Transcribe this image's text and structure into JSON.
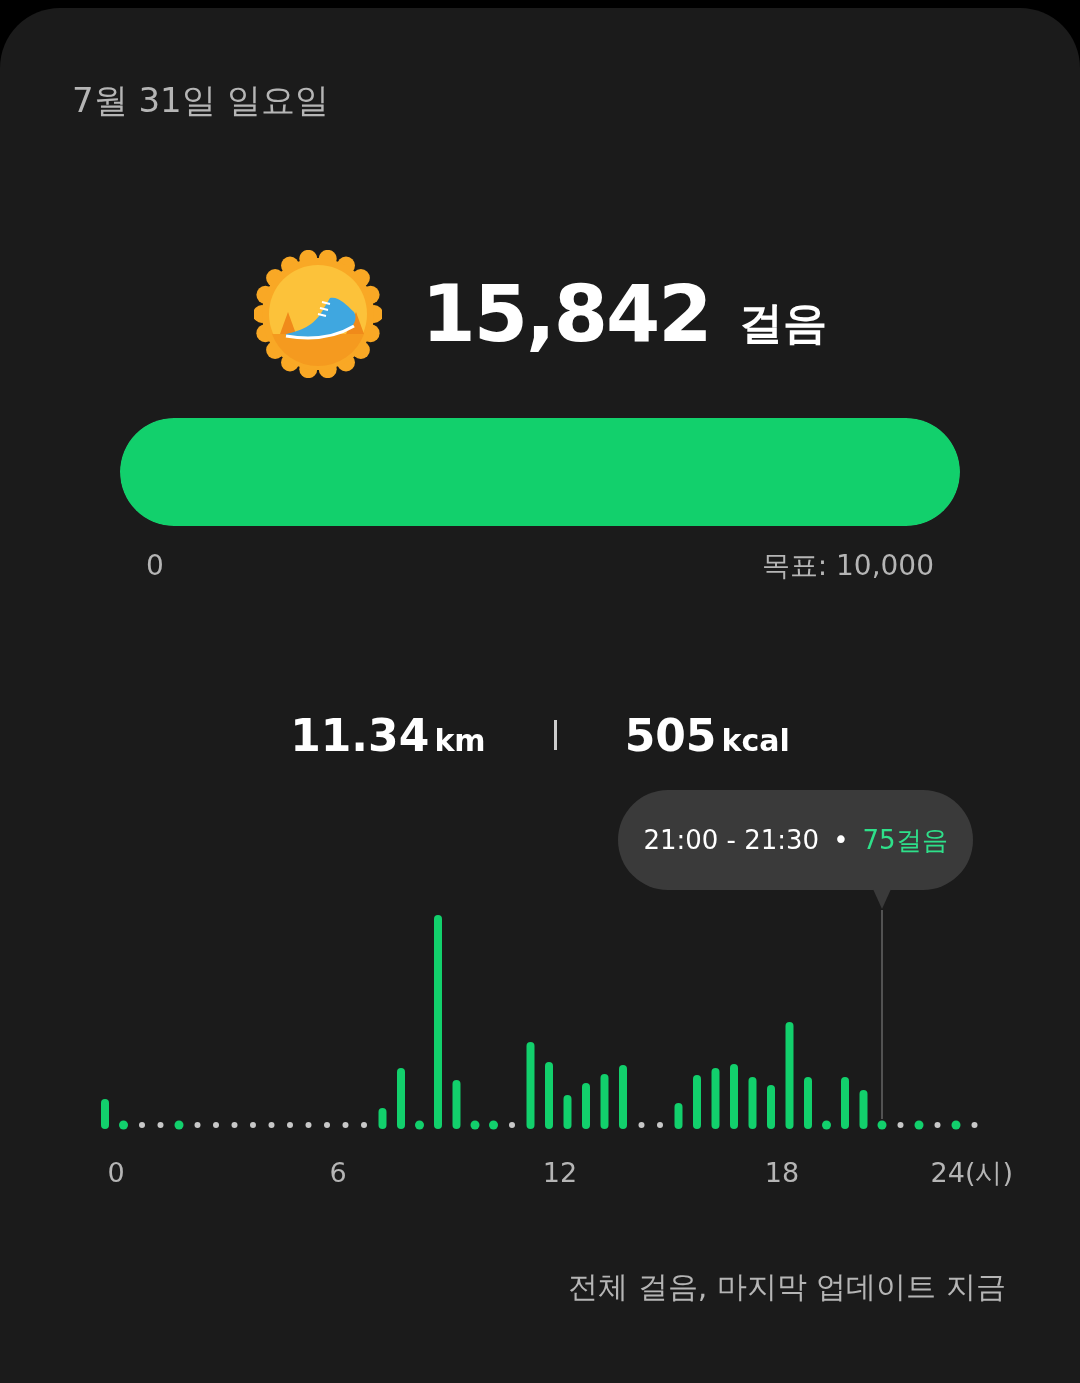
{
  "date": "7월 31일 일요일",
  "steps": {
    "value": "15,842",
    "unit": "걸음"
  },
  "progress": {
    "level": 1,
    "start_label": "0",
    "goal_label": "목표: 10,000"
  },
  "stats": [
    {
      "value": "11.34",
      "unit": "km"
    },
    {
      "value": "505",
      "unit": "kcal"
    }
  ],
  "chart": {
    "tooltip": {
      "range": "21:00 - 21:30",
      "separator": "•",
      "steps": "75걸음"
    },
    "xticks": [
      "0",
      "6",
      "12",
      "18",
      "24(시)"
    ]
  },
  "footer": "전체 걸음, 마지막 업데이트 지금"
}
